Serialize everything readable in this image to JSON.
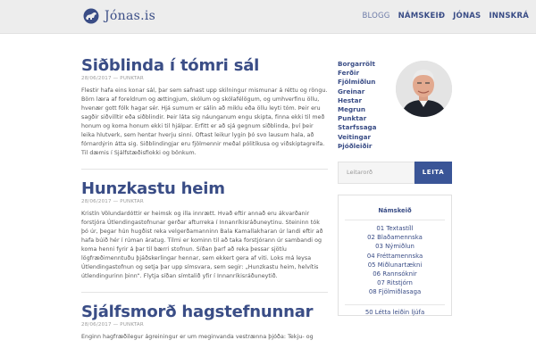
{
  "header": {
    "logo_text": "Jónas.is",
    "logo_icon": "horse-icon",
    "nav": [
      {
        "label": "BLOGG"
      },
      {
        "label": "NÁMSKEIÐ"
      },
      {
        "label": "JÓNAS"
      },
      {
        "label": "INNSKRÁ"
      }
    ]
  },
  "posts": [
    {
      "title": "Siðblinda í tómri sál",
      "meta": "28/06/2017 — PUNKTAR",
      "excerpt": "Flestir hafa eins konar sál, þar sem safnast upp skilningur mismunar á réttu og röngu. Börn læra af foreldrum og ættingjum, skólum og skólafélögum, og umhverfinu öllu, hvenær gott fólk hagar sér. Hjá sumum er sálin að miklu eða öllu leyti tóm. Þeir eru sagðir siðvilltir eða siðblindir. Þeir láta sig náunganum engu skipta, finna ekki til með honum og koma honum ekki til hjálpar. Erfitt er að sjá gegnum siðblinda, því þeir leika hlutverk, sem hentar hverju sinni. Oftast leikur lygin þó svo lausum hala, að fórnardýrin átta sig. Siðblindingjar eru fjölmennir meðal pólitíkusa og viðskiptagreifa. Til dæmis í Sjálfstæðisflokki og bönkum."
    },
    {
      "title": "Hunzkastu heim",
      "meta": "28/06/2017 — PUNKTAR",
      "excerpt": "Kristín Völundardóttir er heimsk og illa innrætt. Hvað eftir annað eru ákvarðanir forstjóra Útlendingastofnunar gerðar afturreka í Innanríkisráðuneytinu. Steininn tók þó úr, þegar hún hugðist reka velgerðamanninn Bala Kamallakharan úr landi eftir að hafa búið hér í rúman áratug. Tilmi er kominn til að taka forstjórann úr sambandi og koma henni fyrir á þar til bærri stofnun. Síðan þarf að reka þessar sjötíu lögfræðimenntuðu þjáðskerlingar hennar, sem ekkert gera af viti. Loks má leysa Útlendingastofnun og setja þar upp símsvara, sem segir: „Hunzkastu heim, helvítis útlendingurinn þinn“. Flytja síðan símtalið yfir í Innanríkisráðuneytið."
    },
    {
      "title": "Sjálfsmorð hagstefnunnar",
      "meta": "28/06/2017 — PUNKTAR",
      "excerpt": "Enginn hagfræðilegur ágreiningur er um meginvanda vestrænna þjóða: Tekju- og"
    }
  ],
  "sidebar": {
    "links": [
      "Borgarrölt",
      "Ferðir",
      "Fjölmiðlun",
      "Greinar",
      "Hestar",
      "Megrun",
      "Punktar",
      "Starfssaga",
      "Veitingar",
      "Þjóðleiðir"
    ],
    "avatar_icon": "author-portrait",
    "search": {
      "placeholder": "Leitarorð",
      "button": "LEITA"
    },
    "courses": {
      "title": "Námskeið",
      "items": [
        "01 Textastíll",
        "02 Blaðamennska",
        "03 Nýmiðlun",
        "04 Fréttamennska",
        "05 Miðlunartækni",
        "06 Rannsóknir",
        "07 Ritstjórn",
        "08 Fjölmiðlasaga"
      ],
      "last": "50 Létta leiðin ljúfa"
    }
  },
  "colors": {
    "accent": "#3a4d86",
    "button": "#3a5597",
    "header_bg": "#ededed"
  }
}
